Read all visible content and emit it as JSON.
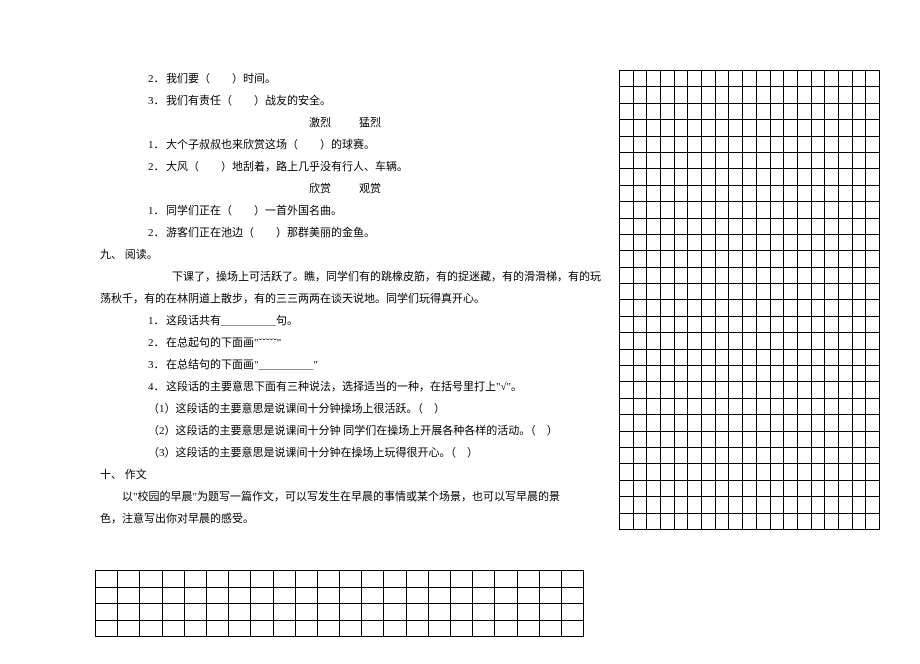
{
  "section8": {
    "items": [
      {
        "num": "2．",
        "text": "我们要（　　）时间。"
      },
      {
        "num": "3．",
        "text": "我们有责任（　　）战友的安全。"
      }
    ],
    "pair2": {
      "w1": "激烈",
      "w2": "猛烈"
    },
    "items2": [
      {
        "num": "1．",
        "text": "大个子叔叔也来欣赏这场（　　）的球赛。"
      },
      {
        "num": "2．",
        "text": "大风（　　）地刮着，路上几乎没有行人、车辆。"
      }
    ],
    "pair3": {
      "w1": "欣赏",
      "w2": "观赏"
    },
    "items3": [
      {
        "num": "1．",
        "text": "同学们正在（　　）一首外国名曲。"
      },
      {
        "num": "2．",
        "text": "游客们正在池边（　　）那群美丽的金鱼。"
      }
    ]
  },
  "section9": {
    "heading": "九、 阅读。",
    "passage_l1": "下课了，操场上可活跃了。瞧，同学们有的跳橡皮筋，有的捉迷藏，有的滑滑梯，有的玩",
    "passage_l2": "荡秋千，有的在林阴道上散步，有的三三两两在谈天说地。同学们玩得真开心。",
    "q1": {
      "num": "1．",
      "text": "这段话共有＿＿＿＿＿句。"
    },
    "q2": {
      "num": "2．",
      "text": "在总起句的下面画\"ˇˇˇˇˇ\""
    },
    "q3": {
      "num": "3．",
      "text": "在总结句的下面画\"＿＿＿＿＿\""
    },
    "q4": {
      "num": "4．",
      "text": "这段话的主要意思下面有三种说法，选择适当的一种，在括号里打上\"√\"。"
    },
    "opt1": "（1）这段话的主要意思是说课间十分钟操场上很活跃。（　）",
    "opt2": "（2）这段话的主要意思是说课间十分钟  同学们在操场上开展各种各样的活动。（　）",
    "opt3": "（3）这段话的主要意思是说课间十分钟在操场上玩得很开心。（　）"
  },
  "section10": {
    "heading": "十、 作文",
    "body_l1": "以\"校园的早晨\"为题写一篇作文，可以写发生在早晨的事情或某个场景，也可以写早晨的景",
    "body_l2": "色，注意写出你对早晨的感受。"
  }
}
